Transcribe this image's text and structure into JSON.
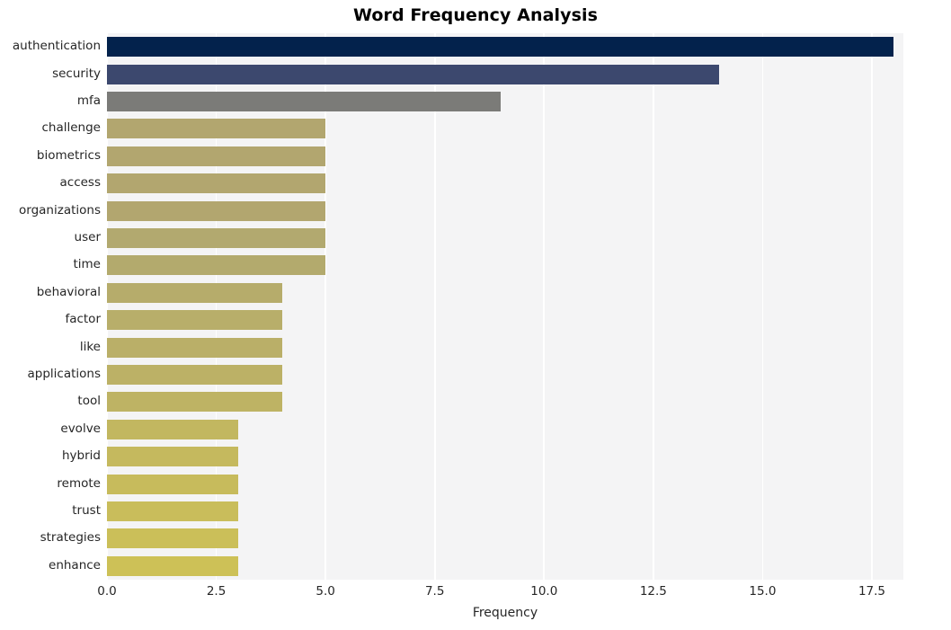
{
  "chart_data": {
    "type": "bar",
    "orientation": "horizontal",
    "title": "Word Frequency Analysis",
    "xlabel": "Frequency",
    "ylabel": "",
    "xlim": [
      0,
      18.22
    ],
    "ylim": [
      0,
      20
    ],
    "grid": true,
    "grid_axis": "x",
    "legend": false,
    "legend_position": "none",
    "plot_background": "#f4f4f5",
    "gridline_color": "#ffffff",
    "figure_background": "#ffffff",
    "x_ticks": [
      "0.0",
      "2.5",
      "5.0",
      "7.5",
      "10.0",
      "12.5",
      "15.0",
      "17.5"
    ],
    "x_tick_values": [
      0,
      2.5,
      5,
      7.5,
      10,
      12.5,
      15,
      17.5
    ],
    "categories": [
      "authentication",
      "security",
      "mfa",
      "challenge",
      "biometrics",
      "access",
      "organizations",
      "user",
      "time",
      "behavioral",
      "factor",
      "like",
      "applications",
      "tool",
      "evolve",
      "hybrid",
      "remote",
      "trust",
      "strategies",
      "enhance"
    ],
    "values": [
      18,
      14,
      9,
      5,
      5,
      5,
      5,
      5,
      5,
      4,
      4,
      4,
      4,
      4,
      3,
      3,
      3,
      3,
      3,
      3
    ],
    "bar_colors": [
      "#03224c",
      "#3c486e",
      "#7b7b78",
      "#b2a66f",
      "#b2a66f",
      "#b2a66f",
      "#b2a66f",
      "#b2a96f",
      "#b3aa6d",
      "#b6ac6b",
      "#b8ae6a",
      "#baaf68",
      "#bcb166",
      "#beb364",
      "#c2b760",
      "#c5b95e",
      "#c7bb5c",
      "#c9bd5b",
      "#cbbf59",
      "#cdc157"
    ]
  }
}
